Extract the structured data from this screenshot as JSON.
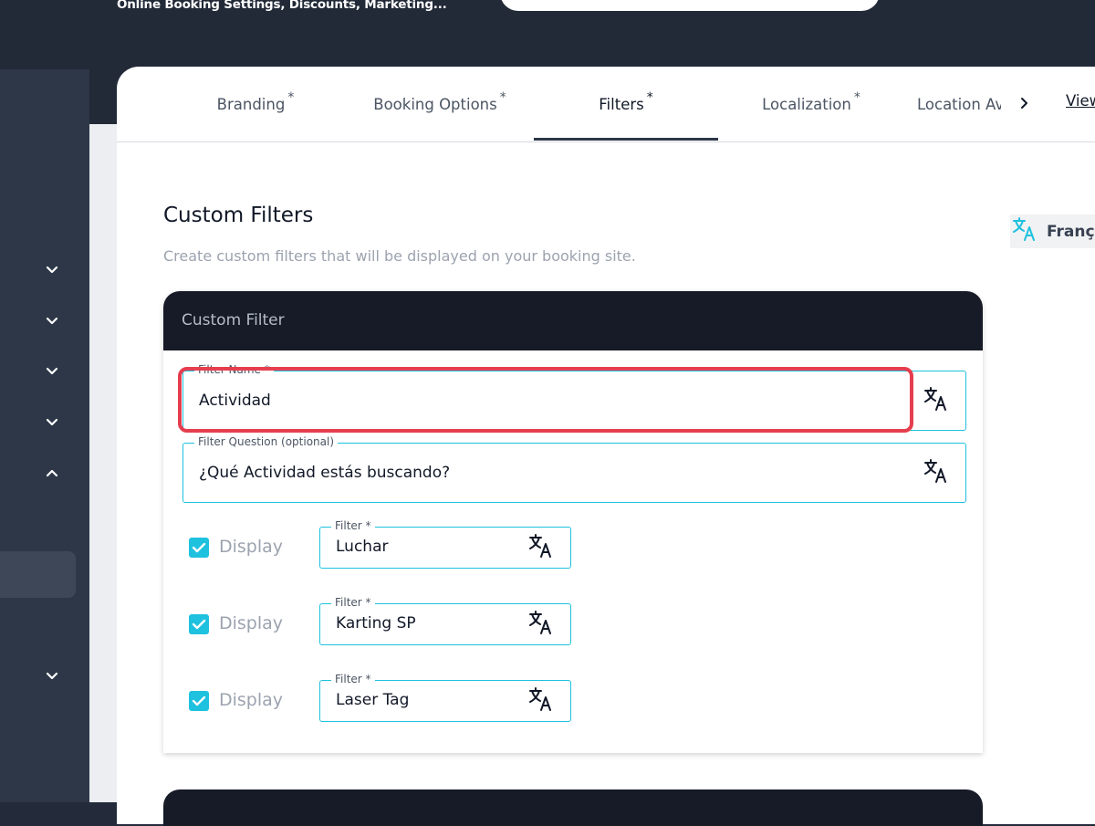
{
  "header": {
    "subtitle": "Online Booking Settings, Discounts, Marketing..."
  },
  "sidebar": {
    "chevrons": [
      {
        "icon": "chevron-down-icon"
      },
      {
        "icon": "chevron-down-icon"
      },
      {
        "icon": "chevron-down-icon"
      },
      {
        "icon": "chevron-down-icon"
      },
      {
        "icon": "chevron-up-icon"
      },
      {
        "icon": "chevron-down-icon"
      }
    ]
  },
  "tabs": {
    "items": [
      {
        "label": "Branding",
        "required": "*"
      },
      {
        "label": "Booking Options",
        "required": "*"
      },
      {
        "label": "Filters",
        "required": "*",
        "active": true
      },
      {
        "label": "Localization",
        "required": "*"
      },
      {
        "label": "Location Av"
      }
    ],
    "next_icon": "chevron-right-icon",
    "view_link": "View"
  },
  "section": {
    "title": "Custom Filters",
    "description": "Create custom filters that will be displayed on your booking site."
  },
  "language": {
    "label": "Franç",
    "icon": "translate-icon"
  },
  "card": {
    "title": "Custom Filter",
    "filter_name": {
      "label": "Filter Name *",
      "value": "Actividad"
    },
    "filter_question": {
      "label": "Filter Question (optional)",
      "value": "¿Qué Actividad estás buscando?"
    },
    "filters": [
      {
        "display_label": "Display",
        "checked": true,
        "label": "Filter *",
        "value": "Luchar"
      },
      {
        "display_label": "Display",
        "checked": true,
        "label": "Filter *",
        "value": "Karting SP"
      },
      {
        "display_label": "Display",
        "checked": true,
        "label": "Filter *",
        "value": "Laser Tag"
      }
    ]
  },
  "colors": {
    "accent": "#1ec1de",
    "highlight": "#e53e4e",
    "dark": "#161b27",
    "sidebar": "#2d3748"
  }
}
